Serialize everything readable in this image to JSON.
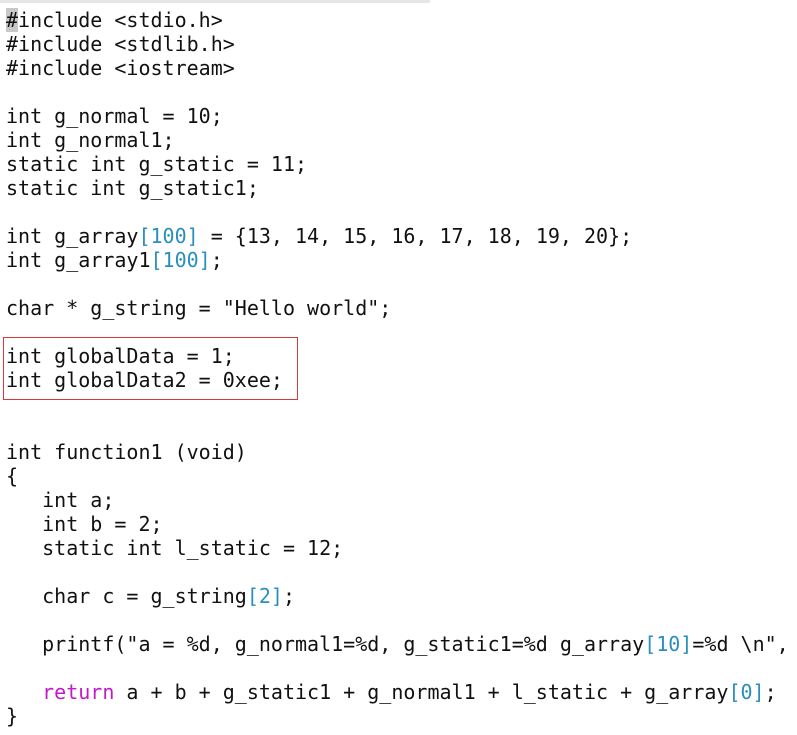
{
  "editor": {
    "cursor_char": "#",
    "lines": {
      "l1_rest": "include <stdio.h>",
      "l2": "#include <stdlib.h>",
      "l3": "#include <iostream>",
      "l5": "int g_normal = 10;",
      "l6": "int g_normal1;",
      "l7": "static int g_static = 11;",
      "l8": "static int g_static1;",
      "l10_a": "int g_array",
      "l10_idx": "[100]",
      "l10_b": " = {13, 14, 15, 16, 17, 18, 19, 20};",
      "l11_a": "int g_array1",
      "l11_idx": "[100]",
      "l11_b": ";",
      "l13": "char * g_string = \"Hello world\";",
      "l15": "int globalData = 1;",
      "l16": "int globalData2 = 0xee;",
      "l19": "int function1 (void)",
      "l20": "{",
      "l21": "   int a;",
      "l22": "   int b = 2;",
      "l23": "   static int l_static = 12;",
      "l25_a": "   char c = g_string",
      "l25_idx": "[2]",
      "l25_b": ";",
      "l27_a": "   printf(\"a = %d, g_normal1=%d, g_static1=%d g_array",
      "l27_idx": "[10]",
      "l27_b": "=%d \\n\",",
      "l29_indent": "   ",
      "l29_kw": "return",
      "l29_a": " a + b + g_static1 + g_normal1 + l_static + g_array",
      "l29_idx": "[0]",
      "l29_b": ";",
      "l30": "}"
    }
  },
  "colors": {
    "text": "#111111",
    "array_index": "#2a8fbf",
    "keyword_return": "#c21ac9",
    "highlight_border": "#d33a3a",
    "cursor_bg": "#c8c8c8"
  }
}
